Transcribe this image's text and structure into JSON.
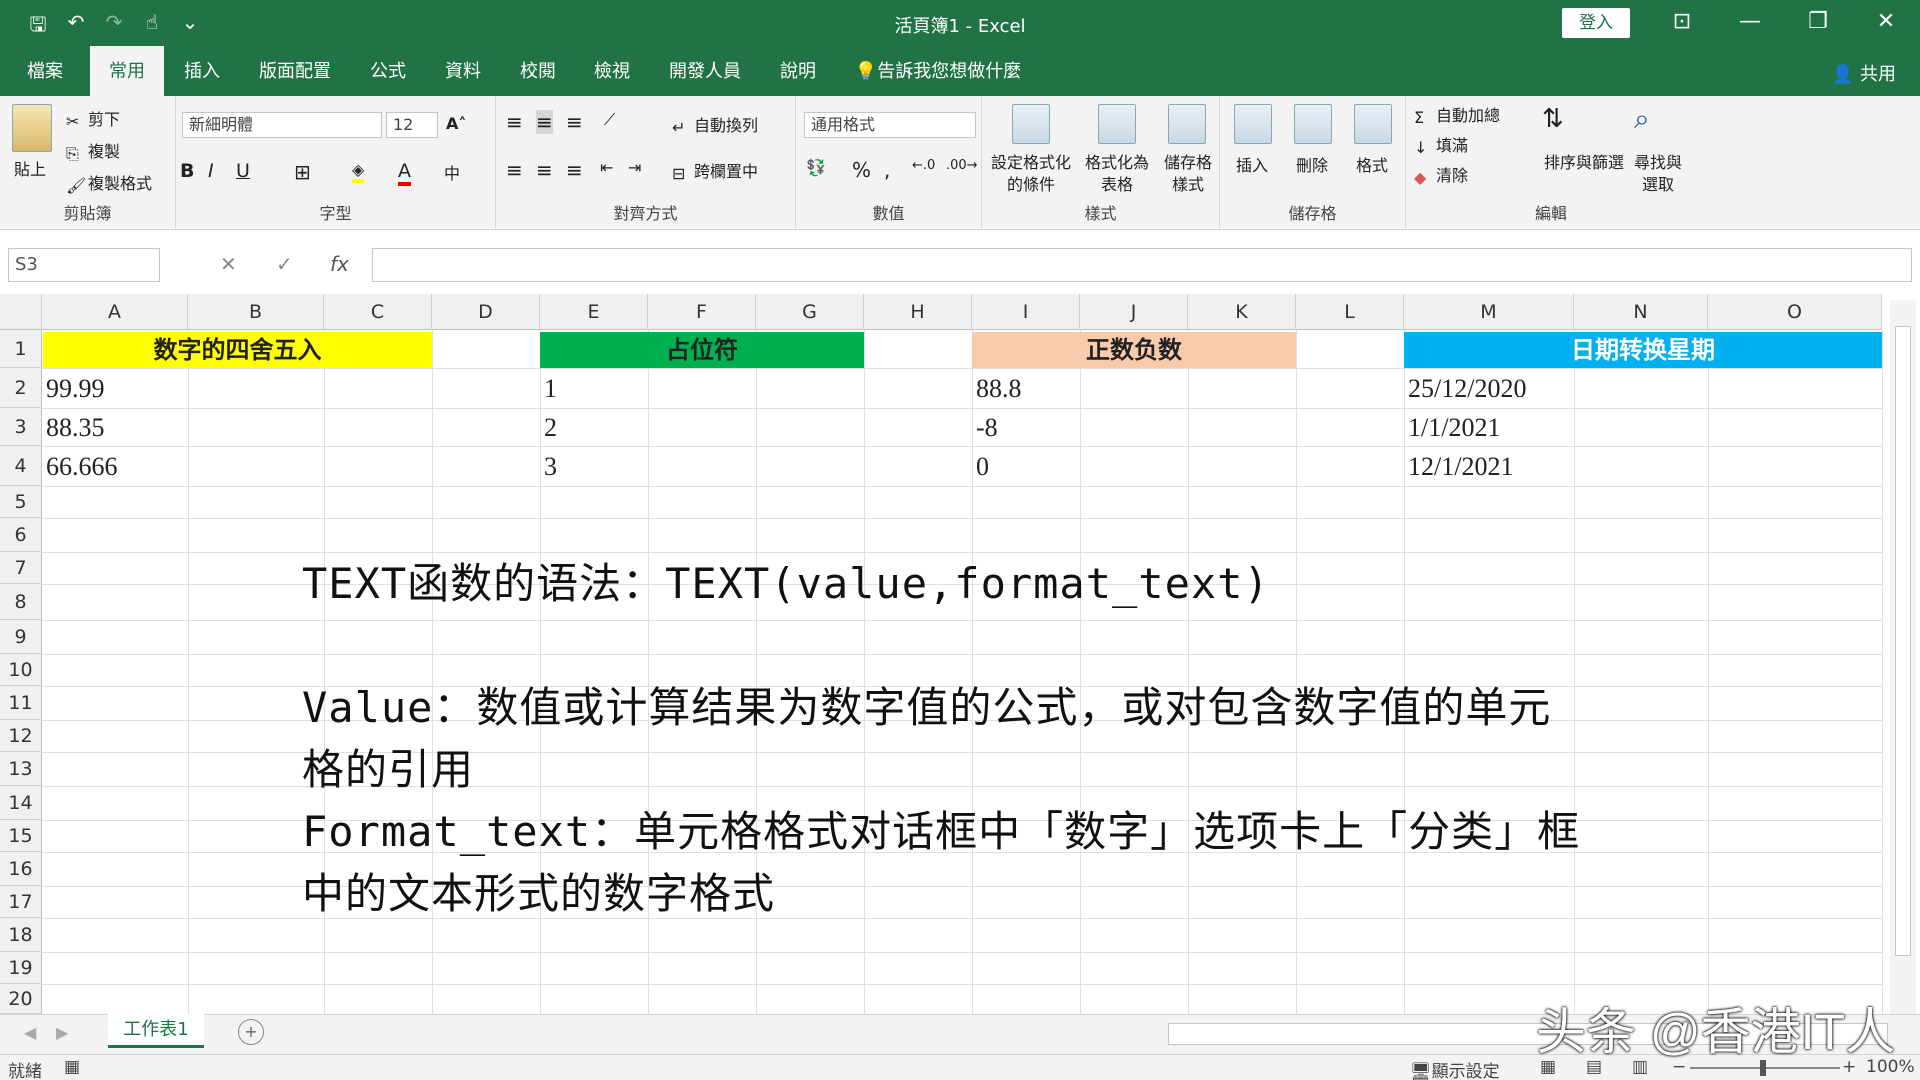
{
  "window": {
    "title": "活頁簿1 - Excel",
    "login": "登入",
    "share": "共用"
  },
  "qat": {
    "save": "🖫",
    "undo": "↶",
    "redo": "↷",
    "touch": "☝",
    "more": "⌄"
  },
  "tabs": [
    "檔案",
    "常用",
    "插入",
    "版面配置",
    "公式",
    "資料",
    "校閱",
    "檢視",
    "開發人員",
    "說明",
    "告訴我您想做什麼"
  ],
  "ribbon": {
    "clipboard": {
      "paste": "貼上",
      "cut": "剪下",
      "copy": "複製",
      "format_painter": "複製格式",
      "label": "剪貼簿"
    },
    "font": {
      "name": "新細明體",
      "size": "12",
      "label": "字型",
      "bold": "B",
      "italic": "I",
      "underline": "U",
      "grow": "A˄",
      "shrink": "A˅",
      "fontcolor": "A"
    },
    "alignment": {
      "wrap": "自動換列",
      "merge": "跨欄置中",
      "label": "對齊方式"
    },
    "number": {
      "format": "通用格式",
      "label": "數值",
      "percent": "%",
      "comma": ","
    },
    "styles": {
      "cond": "設定格式化的條件",
      "table": "格式化為表格",
      "cell": "儲存格樣式",
      "label": "樣式"
    },
    "cells": {
      "insert": "插入",
      "delete": "刪除",
      "format": "格式",
      "label": "儲存格"
    },
    "editing": {
      "autosum": "自動加總",
      "fill": "填滿",
      "clear": "清除",
      "sort": "排序與篩選",
      "find": "尋找與選取",
      "label": "編輯"
    }
  },
  "formula_bar": {
    "name_box": "S3",
    "cancel": "✕",
    "enter": "✓",
    "fx": "fx",
    "formula": ""
  },
  "grid": {
    "columns": [
      "A",
      "B",
      "C",
      "D",
      "E",
      "F",
      "G",
      "H",
      "I",
      "J",
      "K",
      "L",
      "M",
      "N",
      "O"
    ],
    "rows": [
      "1",
      "2",
      "3",
      "4",
      "5",
      "6",
      "7",
      "8",
      "9",
      "10",
      "11",
      "12",
      "13",
      "14",
      "15",
      "16",
      "17",
      "18",
      "19",
      "20"
    ],
    "headers": [
      {
        "text": "数字的四舍五入",
        "color": "#ffff00"
      },
      {
        "text": "占位符",
        "color": "#00b050"
      },
      {
        "text": "正数负数",
        "color": "#f8cbad"
      },
      {
        "text": "日期转换星期",
        "color": "#00b0f0"
      }
    ],
    "col_a": [
      "99.99",
      "88.35",
      "66.666"
    ],
    "col_e": [
      "1",
      "2",
      "3"
    ],
    "col_i": [
      "88.8",
      "-8",
      "0"
    ],
    "col_m": [
      "25/12/2020",
      "1/1/2021",
      "12/1/2021"
    ],
    "notes": [
      "TEXT函数的语法：TEXT(value,format_text)",
      "Value：数值或计算结果为数字值的公式，或对包含数字值的单元",
      "格的引用",
      "Format_text：单元格格式对话框中「数字」选项卡上「分类」框",
      "中的文本形式的数字格式"
    ]
  },
  "sheet": {
    "tab": "工作表1",
    "add": "+"
  },
  "status": {
    "ready": "就緒",
    "display": "顯示設定",
    "zoom": "100%"
  },
  "watermark": "头条 @香港IT人"
}
